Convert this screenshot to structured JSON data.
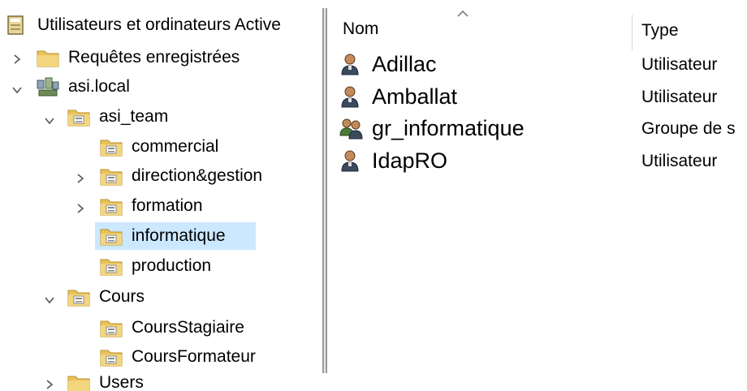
{
  "tree": {
    "root_label": "Utilisateurs et ordinateurs Active",
    "saved_queries_label": "Requêtes enregistrées",
    "domain_label": "asi.local",
    "asi_team_label": "asi_team",
    "asi_team_children": [
      "commercial",
      "direction&gestion",
      "formation",
      "informatique",
      "production"
    ],
    "cours_label": "Cours",
    "cours_children": [
      "CoursStagiaire",
      "CoursFormateur"
    ],
    "users_label": "Users",
    "selected": "informatique"
  },
  "list": {
    "columns": {
      "name": "Nom",
      "type": "Type"
    },
    "rows": [
      {
        "name": "Adillac",
        "type": "Utilisateur",
        "icon": "user-icon"
      },
      {
        "name": "Amballat",
        "type": "Utilisateur",
        "icon": "user-icon"
      },
      {
        "name": "gr_informatique",
        "type": "Groupe de s",
        "icon": "group-icon"
      },
      {
        "name": "IdapRO",
        "type": "Utilisateur",
        "icon": "user-icon"
      }
    ]
  },
  "colors": {
    "selection": "#cce8ff",
    "folder_yellow": "#e9c25a",
    "user_head": "#c48b5a",
    "user_body": "#3b4a5c"
  }
}
